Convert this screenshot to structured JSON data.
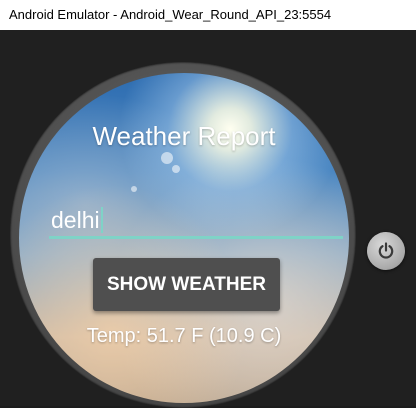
{
  "window": {
    "title": "Android Emulator - Android_Wear_Round_API_23:5554"
  },
  "app": {
    "title": "Weather Report",
    "city_input": {
      "value": "delhi"
    },
    "show_button_label": "SHOW WEATHER",
    "temperature_text": "Temp: 51.7 F (10.9 C)"
  },
  "icons": {
    "power": "power-icon"
  },
  "colors": {
    "input_underline": "#7fd3c7",
    "button_background": "#4f4f4f"
  }
}
